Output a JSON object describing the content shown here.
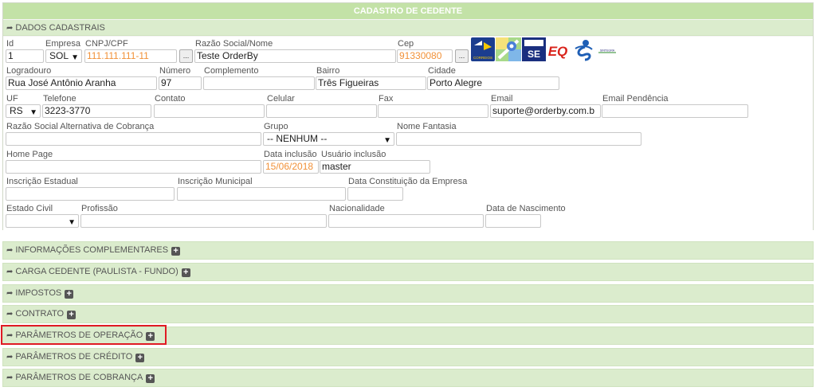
{
  "header": {
    "title": "CADASTRO DE CEDENTE"
  },
  "section": {
    "title": "DADOS CADASTRAIS"
  },
  "fields": {
    "id": {
      "label": "Id",
      "value": "1"
    },
    "empresa": {
      "label": "Empresa",
      "value": "SOL"
    },
    "cnpj": {
      "label": "CNPJ/CPF",
      "value": "111.111.111-11"
    },
    "razao_social": {
      "label": "Razão Social/Nome",
      "value": "Teste OrderBy"
    },
    "cep": {
      "label": "Cep",
      "value": "91330080"
    },
    "logradouro": {
      "label": "Logradouro",
      "value": "Rua José Antônio Aranha"
    },
    "numero": {
      "label": "Número",
      "value": "97"
    },
    "complemento": {
      "label": "Complemento",
      "value": ""
    },
    "bairro": {
      "label": "Bairro",
      "value": "Três Figueiras"
    },
    "cidade": {
      "label": "Cidade",
      "value": "Porto Alegre"
    },
    "uf": {
      "label": "UF",
      "value": "RS"
    },
    "telefone": {
      "label": "Telefone",
      "value": "3223-3770"
    },
    "contato": {
      "label": "Contato",
      "value": ""
    },
    "celular": {
      "label": "Celular",
      "value": ""
    },
    "fax": {
      "label": "Fax",
      "value": ""
    },
    "email": {
      "label": "Email",
      "value": "suporte@orderby.com.b"
    },
    "email_pendencia": {
      "label": "Email Pendência",
      "value": ""
    },
    "razao_alt": {
      "label": "Razão Social Alternativa de Cobrança",
      "value": ""
    },
    "grupo": {
      "label": "Grupo",
      "value": "-- NENHUM --"
    },
    "nome_fantasia": {
      "label": "Nome Fantasia",
      "value": ""
    },
    "home_page": {
      "label": "Home Page",
      "value": ""
    },
    "data_inclusao": {
      "label": "Data inclusão",
      "value": "15/06/2018"
    },
    "usuario_inclusao": {
      "label": "Usuário inclusão",
      "value": "master"
    },
    "inscricao_estadual": {
      "label": "Inscrição Estadual",
      "value": ""
    },
    "inscricao_municipal": {
      "label": "Inscrição Municipal",
      "value": ""
    },
    "data_constituicao": {
      "label": "Data Constituição da Empresa",
      "value": ""
    },
    "estado_civil": {
      "label": "Estado Civil",
      "value": ""
    },
    "profissao": {
      "label": "Profissão",
      "value": ""
    },
    "nacionalidade": {
      "label": "Nacionalidade",
      "value": ""
    },
    "data_nascimento": {
      "label": "Data de Nascimento",
      "value": ""
    }
  },
  "buttons": {
    "dots": "..."
  },
  "logos": {
    "correios": "CORREIOS",
    "receita": "SE",
    "eq": "EQ",
    "sintegra": "SINTEGRA"
  },
  "accordion": [
    {
      "label": "INFORMAÇÕES COMPLEMENTARES"
    },
    {
      "label": "CARGA CEDENTE (PAULISTA - FUNDO)"
    },
    {
      "label": "IMPOSTOS"
    },
    {
      "label": "CONTRATO"
    },
    {
      "label": "PARÂMETROS DE OPERAÇÃO"
    },
    {
      "label": "PARÂMETROS DE CRÉDITO"
    },
    {
      "label": "PARÂMETROS DE COBRANÇA"
    }
  ],
  "colors": {
    "header_green": "#c3e2a7",
    "bar_green": "#dbeccd",
    "highlight_red": "#e01b24",
    "date_orange": "#f19138"
  }
}
